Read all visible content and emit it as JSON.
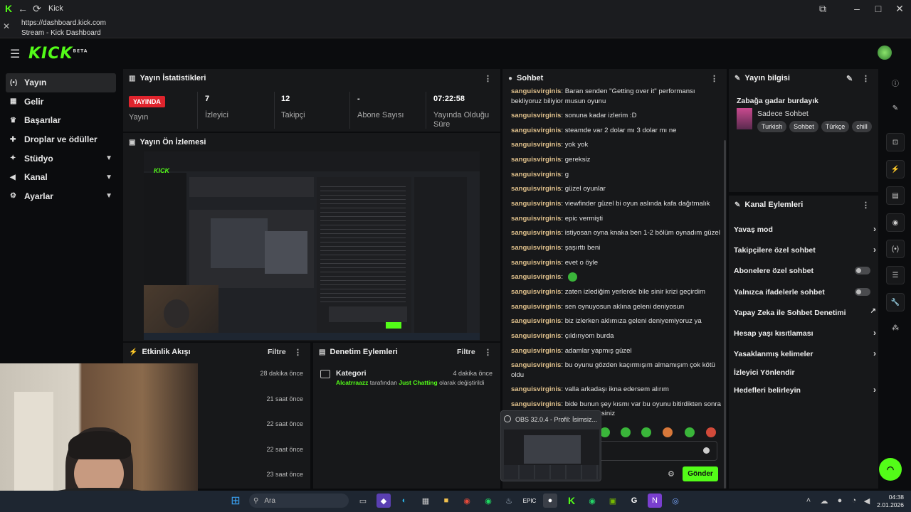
{
  "window": {
    "title": "Kick",
    "url": "https://dashboard.kick.com",
    "tab_title": "Stream - Kick Dashboard"
  },
  "brand": {
    "logo": "KICK",
    "logo_sup": "BETA",
    "accent": "#53fc18"
  },
  "sidebar": {
    "items": [
      {
        "label": "Yayın",
        "icon": "broadcast-icon",
        "active": true
      },
      {
        "label": "Gelir",
        "icon": "bars-icon"
      },
      {
        "label": "Başarılar",
        "icon": "trophy-icon"
      },
      {
        "label": "Droplar ve ödüller",
        "icon": "gift-icon"
      },
      {
        "label": "Stüdyo",
        "icon": "studio-icon",
        "expand": true
      },
      {
        "label": "Kanal",
        "icon": "channel-icon",
        "expand": true
      },
      {
        "label": "Ayarlar",
        "icon": "gear-icon",
        "expand": true
      }
    ]
  },
  "stats": {
    "title": "Yayın İstatistikleri",
    "live_badge": "YAYINDA",
    "items": [
      {
        "value": "",
        "label": "Yayın"
      },
      {
        "value": "7",
        "label": "İzleyici"
      },
      {
        "value": "12",
        "label": "Takipçi"
      },
      {
        "value": "-",
        "label": "Abone Sayısı"
      },
      {
        "value": "07:22:58",
        "label": "Yayında Olduğu Süre"
      }
    ]
  },
  "preview": {
    "title": "Yayın Ön İzlemesi"
  },
  "activity": {
    "title": "Etkinlik Akışı",
    "filter": "Filtre",
    "times": [
      "28 dakika önce",
      "21 saat önce",
      "22 saat önce",
      "22 saat önce",
      "23 saat önce"
    ]
  },
  "moderation": {
    "title": "Denetim Eylemleri",
    "filter": "Filtre",
    "item_title": "Kategori",
    "item_time": "4 dakika önce",
    "item_user": "Alcatrraazz",
    "item_mid": "tarafından",
    "item_cat": "Just Chatting",
    "item_end": "olarak değiştirildi"
  },
  "chat": {
    "title": "Sohbet",
    "messages": [
      {
        "user": "sanguisvirginis",
        "text": "Baran senden \"Getting over it\" performansı bekliyoruz biliyior musun oyunu"
      },
      {
        "user": "sanguisvirginis",
        "text": "sonuna kadar izlerim :D"
      },
      {
        "user": "sanguisvirginis",
        "text": "steamde var 2 dolar mı 3 dolar mı ne"
      },
      {
        "user": "sanguisvirginis",
        "text": "yok yok"
      },
      {
        "user": "sanguisvirginis",
        "text": "gereksiz"
      },
      {
        "user": "sanguisvirginis",
        "text": "g"
      },
      {
        "user": "sanguisvirginis",
        "text": "güzel oyunlar"
      },
      {
        "user": "sanguisvirginis",
        "text": "viewfinder güzel bi oyun aslında kafa dağıtmalık"
      },
      {
        "user": "sanguisvirginis",
        "text": "epic vermişti"
      },
      {
        "user": "sanguisvirginis",
        "text": "istiyosan oyna knaka ben 1-2 bölüm oynadım güzel"
      },
      {
        "user": "sanguisvirginis",
        "text": "şaşırttı beni"
      },
      {
        "user": "sanguisvirginis",
        "text": "evet o öyle"
      },
      {
        "user": "sanguisvirginis",
        "text": ""
      },
      {
        "user": "sanguisvirginis",
        "text": "zaten izlediğim yerlerde bile sinir krizi geçirdim"
      },
      {
        "user": "sanguisvirginis",
        "text": "sen oynuyosun aklına geleni deniyosun"
      },
      {
        "user": "sanguisvirginis",
        "text": "biz izlerken aklımıza geleni deniyemiyoruz ya"
      },
      {
        "user": "sanguisvirginis",
        "text": "çıldırıyom burda"
      },
      {
        "user": "sanguisvirginis",
        "text": "adamlar yapmış güzel"
      },
      {
        "user": "sanguisvirginis",
        "text": "bu oyunu gözden kaçırmışım almamışım çok kötü oldu"
      },
      {
        "user": "sanguisvirginis",
        "text": "valla arkadaşı ikna edersem alırım"
      },
      {
        "user": "sanguisvirginis",
        "text": "bide bunun şey kısmı var bu oyunu bitirdikten sonra"
      }
    ],
    "trail": "siniz",
    "send_label": "Gönder"
  },
  "obs_tooltip": "OBS 32.0.4 - Profil: İsimsiz...",
  "stream_info": {
    "title": "Yayın bilgisi",
    "stream_title": "Zabağa gadar burdayık",
    "category": "Sadece Sohbet",
    "tags": [
      "Turkish",
      "Sohbet",
      "Türkçe",
      "chill"
    ]
  },
  "channel_actions": {
    "title": "Kanal Eylemleri",
    "items": [
      {
        "label": "Yavaş mod",
        "ctrl": "chevron"
      },
      {
        "label": "Takipçilere özel sohbet",
        "ctrl": "chevron"
      },
      {
        "label": "Abonelere özel sohbet",
        "ctrl": "toggle"
      },
      {
        "label": "Yalnızca ifadelerle sohbet",
        "ctrl": "toggle"
      },
      {
        "label": "Yapay Zeka ile Sohbet Denetimi",
        "ctrl": "external"
      },
      {
        "label": "Hesap yaşı kısıtlaması",
        "ctrl": "chevron"
      },
      {
        "label": "Yasaklanmış kelimeler",
        "ctrl": "chevron"
      },
      {
        "label": "İzleyici Yönlendir",
        "ctrl": "none"
      },
      {
        "label": "Hedefleri belirleyin",
        "ctrl": "chevron"
      }
    ]
  },
  "taskbar": {
    "search": "Ara",
    "time": "04:38",
    "date": "2.01.2026"
  }
}
